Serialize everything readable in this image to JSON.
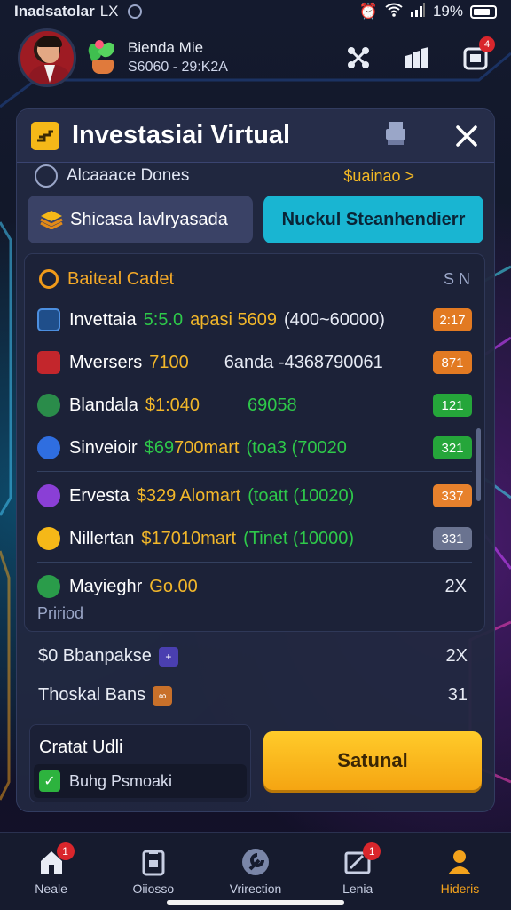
{
  "status_bar": {
    "carrier": "Inadsatolar",
    "network": "LX",
    "battery": "19%"
  },
  "header": {
    "name": "Bienda Mie",
    "sub": "S6060 - 29:K2A",
    "notification_count": "4"
  },
  "panel": {
    "title": "Investasiai Virtual",
    "nav": {
      "label": "Alcaaace Dones",
      "link": "$uainao >"
    },
    "btn_secondary": "Shicasa lavlryasada",
    "btn_primary": "Nuckul Steanhendierr",
    "card": {
      "title": "Baiteal Cadet",
      "sort": "S N",
      "rows": [
        {
          "name": "Invettaia",
          "v1": "5:5.0",
          "v2": "apasi 5609",
          "v3": "(400~60000)",
          "tag": "2:17"
        },
        {
          "name": "Mversers",
          "v1": "7100",
          "v2": "",
          "v3": "6anda -4368790061",
          "tag": "871"
        },
        {
          "name": "Blandala",
          "v1": "$1:040",
          "v2": "",
          "v3": "69058",
          "tag": "121"
        },
        {
          "name": "Sinveioir",
          "v1": "$69",
          "v2": "700mart",
          "v3": "(toa3 (70020",
          "tag": "321"
        },
        {
          "name": "Ervesta",
          "v1": "$329",
          "v2": "Alomart",
          "v3": "(toatt (10020)",
          "tag": "337"
        },
        {
          "name": "Nillertan",
          "v1": "$17",
          "v2": "010mart",
          "v3": "(Tinet (10000)",
          "tag": "331"
        },
        {
          "name": "Mayieghr",
          "v1": "Go.00",
          "v2": "",
          "v3": "",
          "tag": "2X",
          "sub": "Pririod"
        }
      ]
    },
    "extra_rows": [
      {
        "label": "$0 Bbanpakse",
        "value": "2X"
      },
      {
        "label": "Thoskal Bans",
        "value": "31"
      }
    ],
    "footer": {
      "label": "Cratat Udli",
      "checkbox_label": "Buhg Psmoaki",
      "submit": "Satunal"
    }
  },
  "bottom_nav": [
    {
      "label": "Neale",
      "badge": "1"
    },
    {
      "label": "Oiiosso",
      "badge": ""
    },
    {
      "label": "Vrirection",
      "badge": ""
    },
    {
      "label": "Lenia",
      "badge": "1"
    },
    {
      "label": "Hideris",
      "badge": ""
    }
  ],
  "colors": {
    "accent_yellow": "#f5b818",
    "accent_cyan": "#19b5d2",
    "panel_bg": "#222840",
    "positive": "#2ec94a"
  }
}
